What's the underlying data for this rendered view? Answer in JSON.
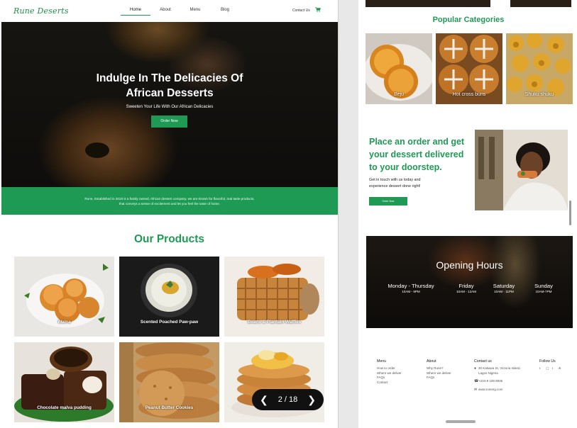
{
  "left": {
    "brand": "Rune Deserts",
    "nav": [
      "Home",
      "About",
      "Menu",
      "Blog"
    ],
    "contact": "Contact Us",
    "hero": {
      "title_line1": "Indulge In The Delicacies Of",
      "title_line2": "African Desserts",
      "subtitle": "Sweeten Your Life With Our African Delicacies",
      "cta": "Order Now"
    },
    "about_line1": "Rune, Established in 2019 is a family owned, African dessert company. we are known for flavorful, real taste products,",
    "about_line2": "that conveys a sense of excitement and let you feel the taste of home.",
    "products_title": "Our Products",
    "products": [
      "Waina",
      "Scented Poached Paw-paw",
      "Beans & Plantain Waffles",
      "Chocolate malva pudding",
      "Peanut Butter Cookies",
      ""
    ],
    "pager": {
      "current": 2,
      "total": 18,
      "label": "2 / 18"
    }
  },
  "right": {
    "categories_title": "Popular Categories",
    "categories": [
      "Beju",
      "Hot cross buns",
      "Shuku shuku"
    ],
    "promo": {
      "heading": "Place an order and get your dessert delivered to your doorstep.",
      "text": "Get in touch with us today and experience dessert done right!",
      "button": "Order Now"
    },
    "hours": {
      "title": "Opening Hours",
      "days": [
        {
          "day": "Monday - Thursday",
          "time": "10AM - 9PM"
        },
        {
          "day": "Friday",
          "time": "10AM - 12AM"
        },
        {
          "day": "Saturday",
          "time": "10AM - 11PM"
        },
        {
          "day": "Sunday",
          "time": "10AM-7PM"
        }
      ]
    },
    "footer": {
      "menu": {
        "title": "Menu",
        "items": [
          "How to order",
          "Where we deliver",
          "FAQs",
          "Contact"
        ]
      },
      "about": {
        "title": "About",
        "items": [
          "Why Rune?",
          "Where we deliver",
          "FAQs"
        ]
      },
      "contact": {
        "title": "Contact us",
        "address_line1": "30 Kakawa St, Victoria Island,",
        "address_line2": "Lagos Nigeria",
        "phone": "+234-9 108 8936",
        "email": "www.runeng.com"
      },
      "follow": {
        "title": "Follow Us"
      }
    }
  },
  "colors": {
    "brand_green": "#1f9a55"
  }
}
